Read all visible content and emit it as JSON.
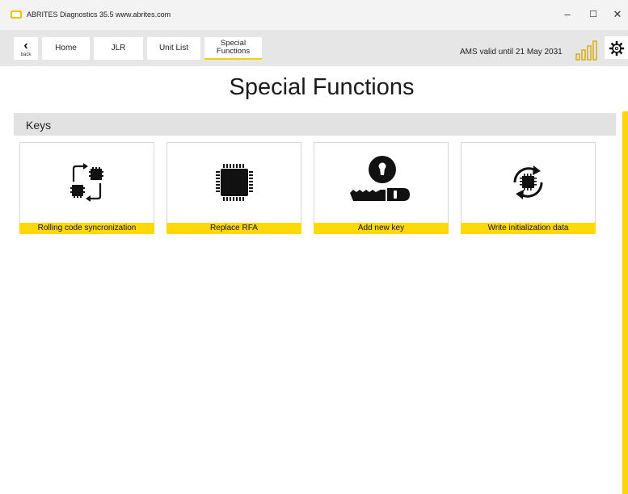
{
  "window": {
    "title": "ABRITES Diagnostics 35.5  www.abrites.com",
    "controls": {
      "minimize": "–",
      "maximize": "☐",
      "close": "✕"
    }
  },
  "toolbar": {
    "back_label": "back",
    "back_icon": "‹",
    "tabs": [
      {
        "label": "Home",
        "active": false
      },
      {
        "label": "JLR",
        "active": false
      },
      {
        "label": "Unit List",
        "active": false
      },
      {
        "label": "Special Functions",
        "label_lines": [
          "Special",
          "Functions"
        ],
        "active": true
      }
    ],
    "ams_status": "AMS valid until 21 May 2031",
    "signal_icon": "signal-bars-icon",
    "settings_icon": "gear-icon"
  },
  "page": {
    "title": "Special Functions",
    "section": {
      "title": "Keys",
      "tiles": [
        {
          "label": "Rolling code syncronization",
          "icon": "rolling-code-sync-icon"
        },
        {
          "label": "Replace RFA",
          "icon": "chip-icon"
        },
        {
          "label": "Add new key",
          "icon": "add-key-icon"
        },
        {
          "label": "Write initialization data",
          "icon": "write-init-chip-icon"
        }
      ]
    }
  },
  "colors": {
    "accent": "#ffd80a",
    "toolbar_bg": "#e6e6e6",
    "section_bg": "#e2e2e2",
    "titlebar_bg": "#f3f3f3"
  }
}
